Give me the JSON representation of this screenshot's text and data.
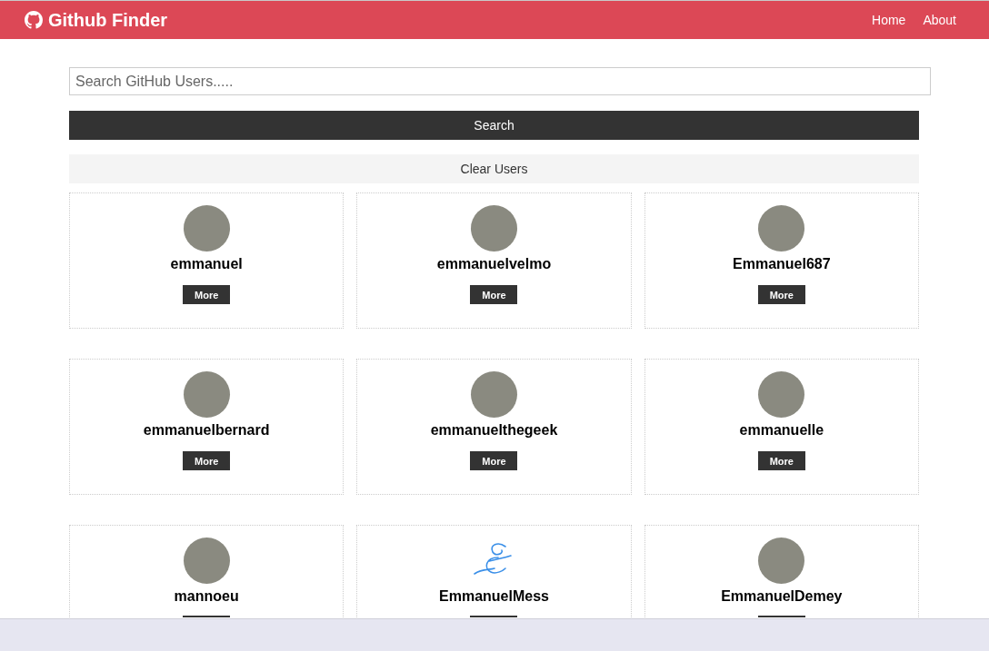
{
  "navbar": {
    "title": "Github Finder",
    "links": [
      "Home",
      "About"
    ]
  },
  "search": {
    "placeholder": "Search GitHub Users.....",
    "button": "Search",
    "clear": "Clear Users"
  },
  "users": [
    {
      "login": "emmanuel",
      "kind": "photo",
      "button": "More"
    },
    {
      "login": "emmanuelvelmo",
      "kind": "photo",
      "button": "More"
    },
    {
      "login": "Emmanuel687",
      "kind": "photo",
      "button": "More"
    },
    {
      "login": "emmanuelbernard",
      "kind": "photo",
      "button": "More"
    },
    {
      "login": "emmanuelthegeek",
      "kind": "photo",
      "button": "More"
    },
    {
      "login": "emmanuelle",
      "kind": "photo",
      "button": "More"
    },
    {
      "login": "mannoeu",
      "kind": "photo"
    },
    {
      "login": "EmmanuelMess",
      "kind": "signature"
    },
    {
      "login": "EmmanuelDemey",
      "kind": "photo"
    }
  ]
}
